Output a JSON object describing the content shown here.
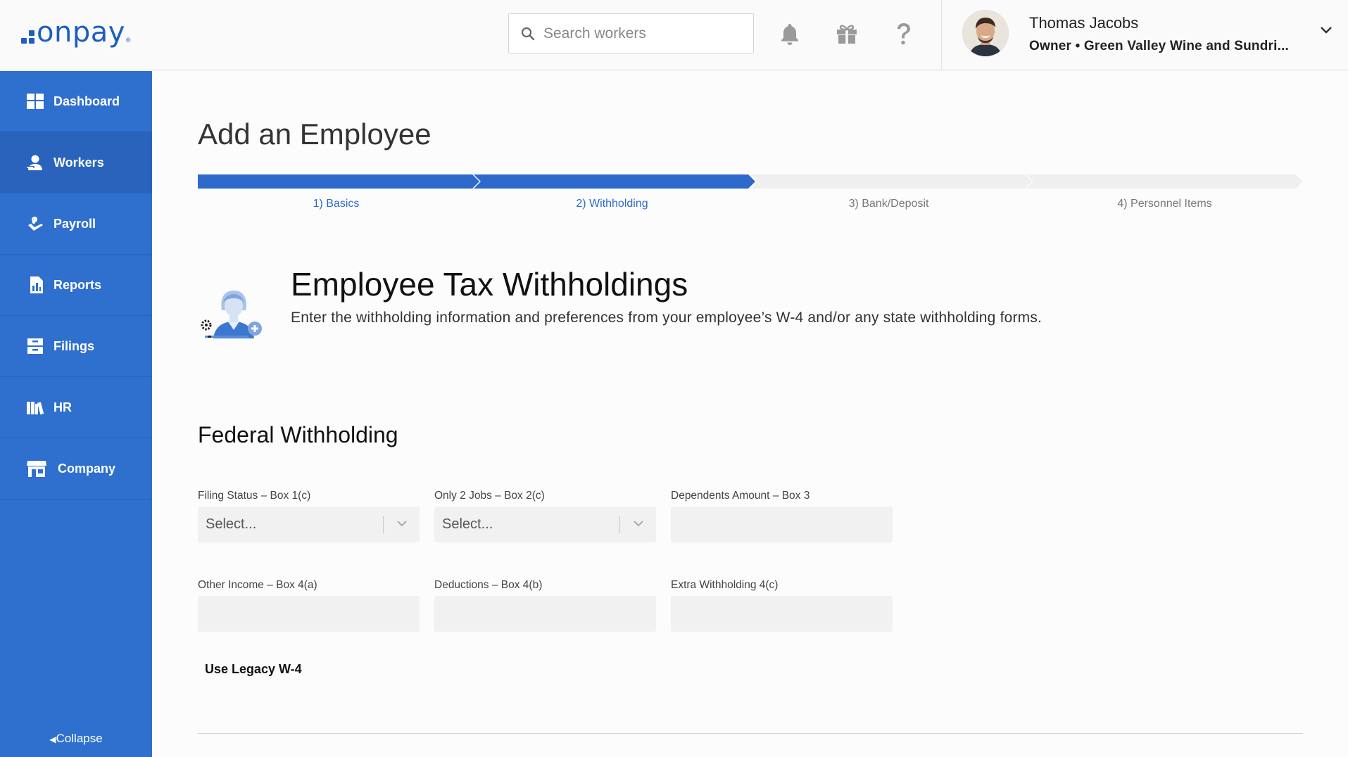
{
  "brand": {
    "logo_text": "onpay",
    "reg_mark": "®",
    "accent": "#2f6fce"
  },
  "header": {
    "search_placeholder": "Search workers",
    "icons": [
      "bell-icon",
      "gift-icon",
      "help-icon"
    ],
    "user": {
      "name": "Thomas Jacobs",
      "subtitle": "Owner • Green Valley Wine and Sundri..."
    }
  },
  "sidebar": {
    "items": [
      {
        "label": "Dashboard",
        "icon": "dashboard-icon"
      },
      {
        "label": "Workers",
        "icon": "workers-icon",
        "active": true
      },
      {
        "label": "Payroll",
        "icon": "payroll-icon"
      },
      {
        "label": "Reports",
        "icon": "reports-icon"
      },
      {
        "label": "Filings",
        "icon": "filings-icon"
      },
      {
        "label": "HR",
        "icon": "hr-icon"
      },
      {
        "label": "Company",
        "icon": "company-icon"
      }
    ],
    "collapse_label": "Collapse"
  },
  "main": {
    "page_title": "Add an Employee",
    "steps": [
      {
        "label": "1) Basics",
        "done": true
      },
      {
        "label": "2) Withholding",
        "done": true
      },
      {
        "label": "3) Bank/Deposit",
        "done": false
      },
      {
        "label": "4) Personnel Items",
        "done": false
      }
    ],
    "tax_title": "Employee Tax Withholdings",
    "tax_desc": "Enter the withholding information and preferences from your employee’s W-4 and/or any state withholding forms.",
    "section_title": "Federal Withholding",
    "fields": {
      "filing_status": {
        "label": "Filing Status – Box 1(c)",
        "value": "Select..."
      },
      "only_2_jobs": {
        "label": "Only 2 Jobs – Box 2(c)",
        "value": "Select..."
      },
      "dependents": {
        "label": "Dependents Amount – Box 3",
        "value": ""
      },
      "other_income": {
        "label": "Other Income – Box 4(a)",
        "value": ""
      },
      "deductions": {
        "label": "Deductions – Box 4(b)",
        "value": ""
      },
      "extra_withholding": {
        "label": "Extra Withholding 4(c)",
        "value": ""
      }
    },
    "legacy_link": "Use Legacy W-4"
  }
}
